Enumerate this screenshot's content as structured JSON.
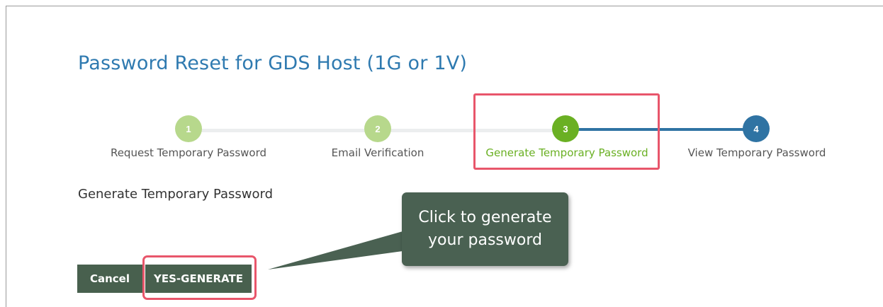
{
  "page": {
    "title": "Password Reset for GDS Host (1G or 1V)"
  },
  "stepper": {
    "steps": [
      {
        "number": "1",
        "label": "Request Temporary Password",
        "state": "complete"
      },
      {
        "number": "2",
        "label": "Email Verification",
        "state": "complete"
      },
      {
        "number": "3",
        "label": "Generate Temporary Password",
        "state": "active"
      },
      {
        "number": "4",
        "label": "View Temporary Password",
        "state": "pending"
      }
    ]
  },
  "section": {
    "title": "Generate Temporary Password"
  },
  "buttons": {
    "cancel_label": "Cancel",
    "generate_label": "YES-GENERATE"
  },
  "callout": {
    "text": "Click to generate your password"
  },
  "colors": {
    "title_blue": "#2f7ab0",
    "step_complete": "#b7d88c",
    "step_active": "#6ab023",
    "step_pending": "#2f73a3",
    "button_bg": "#48604e",
    "highlight": "#e8566b",
    "callout_bg": "#4a6152"
  }
}
